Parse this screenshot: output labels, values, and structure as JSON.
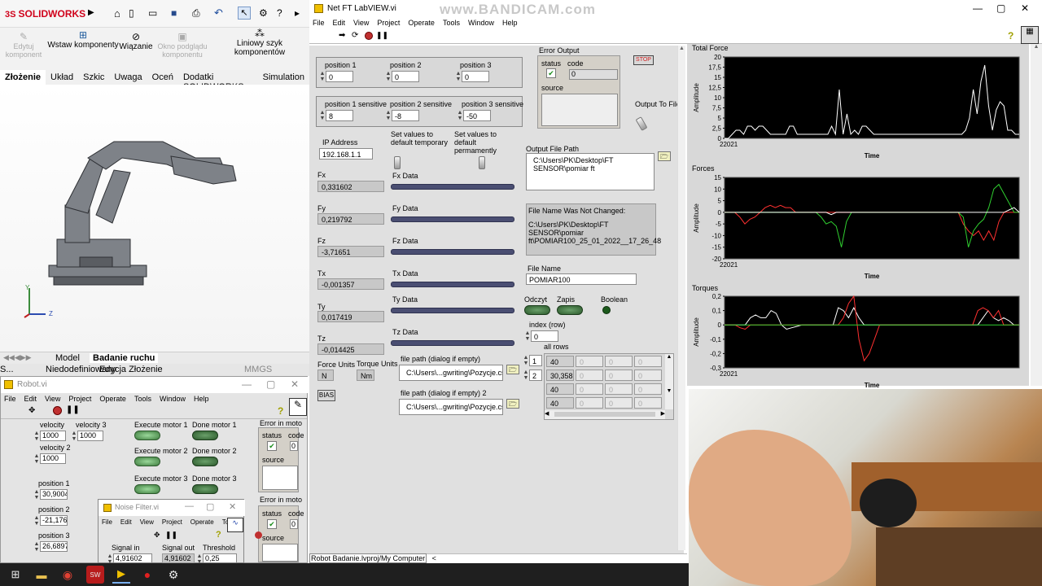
{
  "watermark": "www.BANDICAM.com",
  "solidworks": {
    "brand": "SOLIDWORKS",
    "ribbon": [
      "Edytuj komponent",
      "Wstaw komponenty",
      "Wiązanie",
      "Okno podglądu komponentu",
      "Liniowy szyk komponentów"
    ],
    "tabs": [
      "Złożenie",
      "Układ",
      "Szkic",
      "Uwaga",
      "Oceń",
      "Dodatki SOLIDWORKS",
      "Simulation"
    ],
    "bottom_tabs": [
      "Model",
      "Badanie ruchu"
    ],
    "status": [
      "S...",
      "Niedodefiniowany",
      "Edycja Złożenie"
    ],
    "units": "MMGS",
    "axis_y": "Y",
    "axis_z": "Z"
  },
  "robot_vi": {
    "title": "Robot.vi",
    "menu": [
      "File",
      "Edit",
      "View",
      "Project",
      "Operate",
      "Tools",
      "Window",
      "Help"
    ],
    "velocity1_label": "velocity",
    "velocity1": "1000",
    "velocity3_label": "velocity 3",
    "velocity3": "1000",
    "velocity2_label": "velocity 2",
    "velocity2": "1000",
    "position1_label": "position 1",
    "position1": "30,9004",
    "position2_label": "position 2",
    "position2": "-21,1768",
    "position3_label": "position 3",
    "position3": "26,6897",
    "exec1": "Execute motor 1",
    "done1": "Done motor 1",
    "exec2": "Execute motor 2",
    "done2": "Done motor 2",
    "exec3": "Execute motor 3",
    "done3": "Done motor 3",
    "err1": "Error in moto",
    "err2": "Error in moto",
    "status": "status",
    "code": "code",
    "code_val": "0",
    "source": "source"
  },
  "noise_vi": {
    "title": "Noise Filter.vi",
    "menu": [
      "File",
      "Edit",
      "View",
      "Project",
      "Operate",
      "To"
    ],
    "signal_in_label": "Signal in",
    "signal_in": "4,91602",
    "signal_out_label": "Signal out",
    "signal_out": "4,91602",
    "threshold_label": "Threshold",
    "threshold": "0,25"
  },
  "ft_vi": {
    "title": "Net FT LabVIEW.vi",
    "menu": [
      "File",
      "Edit",
      "View",
      "Project",
      "Operate",
      "Tools",
      "Window",
      "Help"
    ],
    "pos1_label": "position 1",
    "pos1": "0",
    "pos2_label": "position 2",
    "pos2": "0",
    "pos3_label": "position 3",
    "pos3": "0",
    "pos1s_label": "position 1 sensitive",
    "pos1s": "8",
    "pos2s_label": "position 2 sensitive",
    "pos2s": "-8",
    "pos3s_label": "position 3 sensitive",
    "pos3s": "-50",
    "ip_label": "IP Address",
    "ip": "192.168.1.1",
    "set_temp": "Set values to default temporary",
    "set_perm": "Set values to default permamently",
    "fx_label": "Fx",
    "fx": "0,331602",
    "fxd": "Fx Data",
    "fy_label": "Fy",
    "fy": "0,219792",
    "fyd": "Fy Data",
    "fz_label": "Fz",
    "fz": "-3,71651",
    "fzd": "Fz Data",
    "tx_label": "Tx",
    "tx": "-0,001357",
    "txd": "Tx Data",
    "ty_label": "Ty",
    "ty": "0,017419",
    "tyd": "Ty Data",
    "tz_label": "Tz",
    "tz": "-0,014425",
    "tzd": "Tz Data",
    "force_units_label": "Force Units",
    "force_units": "N",
    "torque_units_label": "Torque Units",
    "torque_units": "Nm",
    "bias": "BIAS",
    "error_output": "Error Output",
    "status": "status",
    "code": "code",
    "code_val": "0",
    "source": "source",
    "stop": "STOP",
    "output_to_file": "Output To File?",
    "output_path_label": "Output File Path",
    "output_path": "C:\\Users\\PK\\Desktop\\FT SENSOR\\pomiar ft",
    "fname_msg_title": "File Name Was Not Changed:",
    "fname_msg": "C:\\Users\\PK\\Desktop\\FT SENSOR\\pomiar ft\\POMIAR100_25_01_2022__17_26_48",
    "file_name_label": "File Name",
    "file_name": "POMIAR100",
    "odczyt": "Odczyt",
    "zapis": "Zapis",
    "boolean": "Boolean",
    "index_label": "index (row)",
    "index": "0",
    "all_rows": "all rows",
    "fp1_label": "file path (dialog if empty)",
    "fp1": "C:\\Users\\...gwriting\\Pozycje.csv",
    "fp2_label": "file path (dialog if empty) 2",
    "fp2": "C:\\Users\\...gwriting\\Pozycje.csv",
    "arr_idx1": "1",
    "arr_idx2": "2",
    "table": [
      [
        "40",
        "0",
        "0",
        "0"
      ],
      [
        "30,3588",
        "0",
        "0",
        "0"
      ],
      [
        "40",
        "0",
        "0",
        "0"
      ],
      [
        "40",
        "0",
        "0",
        "0"
      ]
    ],
    "project_bar": "Robot Badanie.lvproj/My Computer"
  },
  "charts": {
    "total_force": {
      "title": "Total Force",
      "ylabel": "Amplitude",
      "xlabel": "Time",
      "xstart": "22021",
      "yticks": [
        "20",
        "17,5",
        "15",
        "12,5",
        "10",
        "7,5",
        "5",
        "2,5",
        "0"
      ]
    },
    "forces": {
      "title": "Forces",
      "ylabel": "Amplitude",
      "xlabel": "Time",
      "xstart": "22021",
      "yticks": [
        "15",
        "10",
        "5",
        "0",
        "-5",
        "-10",
        "-15",
        "-20"
      ]
    },
    "torques": {
      "title": "Torques",
      "ylabel": "Amplitude",
      "xlabel": "Time",
      "xstart": "22021",
      "yticks": [
        "0,2",
        "0,1",
        "0",
        "-0,1",
        "-0,2",
        "-0,3"
      ]
    }
  },
  "chart_data": [
    {
      "type": "line",
      "title": "Total Force",
      "ylim": [
        0,
        20
      ],
      "series": [
        {
          "color": "#ffffff",
          "values": [
            0,
            0,
            1,
            2,
            2,
            1,
            3,
            3,
            2,
            3,
            3,
            2,
            1,
            1,
            1,
            1,
            1,
            3,
            3,
            1,
            1,
            1,
            1,
            1,
            1,
            1,
            1,
            1,
            3,
            1,
            12,
            1,
            6,
            1,
            2,
            1,
            3,
            3,
            2,
            1,
            1,
            1,
            1,
            1,
            1,
            1,
            1,
            1,
            1,
            1,
            1,
            1,
            1,
            1,
            1,
            1,
            1,
            1,
            1,
            1,
            1,
            1,
            1,
            2,
            5,
            12,
            6,
            14,
            18,
            8,
            2,
            7,
            9,
            8,
            2,
            2,
            1,
            1
          ]
        }
      ]
    },
    {
      "type": "line",
      "title": "Forces",
      "ylim": [
        -20,
        15
      ],
      "series": [
        {
          "color": "#ff3030",
          "values": [
            0,
            0,
            0,
            -2,
            -5,
            -3,
            -2,
            0,
            2,
            3,
            2,
            3,
            2,
            2,
            0,
            0,
            0,
            0,
            0,
            0,
            0,
            0,
            0,
            0,
            0,
            0,
            0,
            0,
            0,
            0,
            0,
            0,
            0,
            0,
            0,
            0,
            0,
            0,
            0,
            0,
            0,
            0,
            0,
            0,
            0,
            0,
            0,
            -5,
            -8,
            -10,
            -8,
            -12,
            -8,
            -12,
            -4,
            0,
            0,
            0,
            0
          ]
        },
        {
          "color": "#30d030",
          "values": [
            0,
            0,
            0,
            0,
            0,
            0,
            0,
            0,
            0,
            0,
            0,
            0,
            0,
            0,
            0,
            0,
            0,
            0,
            0,
            -2,
            -5,
            -4,
            -6,
            -15,
            -4,
            0,
            0,
            0,
            0,
            0,
            0,
            0,
            0,
            0,
            0,
            0,
            0,
            0,
            0,
            0,
            0,
            0,
            0,
            0,
            0,
            0,
            0,
            -2,
            -15,
            -8,
            -5,
            -3,
            2,
            10,
            12,
            8,
            4,
            0,
            0
          ]
        },
        {
          "color": "#ffffff",
          "values": [
            0,
            0,
            0,
            0,
            0,
            0,
            0,
            0,
            0,
            0,
            0,
            0,
            0,
            0,
            0,
            0,
            0,
            0,
            0,
            0,
            0,
            -1,
            0,
            0,
            0,
            0,
            0,
            0,
            0,
            0,
            0,
            0,
            0,
            0,
            0,
            0,
            0,
            0,
            0,
            0,
            0,
            0,
            0,
            0,
            0,
            0,
            0,
            0,
            0,
            0,
            0,
            0,
            0,
            0,
            0,
            0,
            1,
            2,
            0
          ]
        }
      ]
    },
    {
      "type": "line",
      "title": "Torques",
      "ylim": [
        -0.3,
        0.2
      ],
      "series": [
        {
          "color": "#ffffff",
          "values": [
            0,
            0,
            0,
            0,
            0,
            0.05,
            0.07,
            0.05,
            0.05,
            0.1,
            0.08,
            0,
            -0.03,
            -0.02,
            -0.01,
            0,
            0,
            0,
            0,
            0,
            0,
            0,
            0.12,
            0.1,
            0.05,
            0.12,
            0.05,
            0,
            0,
            0,
            0,
            0,
            0,
            0,
            0,
            0,
            0,
            0,
            0,
            0,
            0,
            0,
            0,
            0,
            0,
            0,
            0,
            0,
            0,
            0,
            0.05,
            0.1,
            0.05,
            0.03,
            0.05,
            0.03,
            0,
            0
          ]
        },
        {
          "color": "#ff3030",
          "values": [
            0,
            0,
            0,
            -0.02,
            -0.03,
            0,
            0,
            0,
            0,
            0,
            0,
            0,
            0,
            0,
            0,
            0,
            0,
            0,
            0,
            0,
            0,
            0,
            0,
            0.05,
            0.15,
            0.2,
            -0.1,
            -0.25,
            -0.2,
            -0.1,
            0,
            0,
            0,
            0,
            0,
            0,
            0,
            0,
            0,
            0,
            0,
            0,
            0,
            0,
            0,
            0,
            0,
            0,
            0,
            0.1,
            0.12,
            0.1,
            0.05,
            0.1,
            0,
            0,
            0,
            0
          ]
        },
        {
          "color": "#30d030",
          "values": [
            0,
            0,
            0,
            0,
            0,
            0,
            0,
            0,
            0,
            0,
            0,
            0,
            0,
            0,
            0,
            0,
            0,
            0,
            0,
            0,
            0,
            0,
            0,
            0,
            0,
            0,
            0,
            0,
            0,
            0,
            0,
            0,
            0,
            0,
            0,
            0,
            0,
            0,
            0,
            0,
            0,
            0,
            0,
            0,
            0,
            0,
            0,
            0,
            0,
            0,
            0,
            0,
            0,
            0,
            0,
            0,
            0,
            0
          ]
        }
      ]
    }
  ]
}
